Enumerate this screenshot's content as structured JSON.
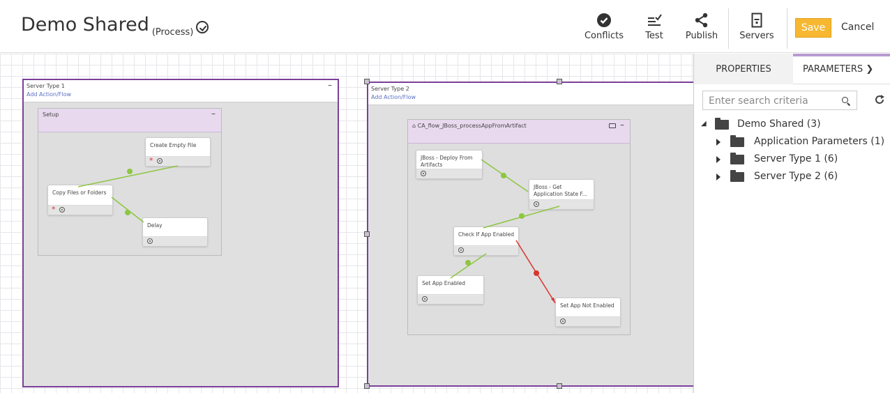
{
  "header": {
    "title": "Demo Shared",
    "subtitle": "(Process)",
    "toolbar": {
      "conflicts": "Conflicts",
      "test": "Test",
      "publish": "Publish",
      "servers": "Servers",
      "save": "Save",
      "cancel": "Cancel"
    }
  },
  "canvas": {
    "lanes": [
      {
        "title": "Server Type 1",
        "add_link": "Add Action/Flow",
        "min": "–",
        "group": {
          "title": "Setup",
          "min": "–",
          "nodes": [
            "Create Empty File",
            "Copy Files or Folders",
            "Delay"
          ],
          "required": "*"
        }
      },
      {
        "title": "Server Type 2",
        "add_link": "Add Action/Flow",
        "group": {
          "title": "⌂ CA_flow_JBoss_processAppFromArtifact",
          "min": "–",
          "nodes": [
            "JBoss - Deploy From Artifacts",
            "JBoss - Get Application State F...",
            "Check If App Enabled",
            "Set App Enabled",
            "Set App Not Enabled"
          ]
        }
      }
    ]
  },
  "panel": {
    "tabs": [
      "PROPERTIES",
      "PARAMETERS"
    ],
    "tab_more": "❯",
    "search_placeholder": "Enter search criteria",
    "tree": {
      "root": "Demo Shared (3)",
      "children": [
        "Application Parameters (1)",
        "Server Type 1 (6)",
        "Server Type 2 (6)"
      ]
    }
  },
  "colors": {
    "save": "#f7b731",
    "lane_border": "#7b3f9a",
    "success_edge": "#8dc63f",
    "failure_edge": "#d9342b"
  }
}
